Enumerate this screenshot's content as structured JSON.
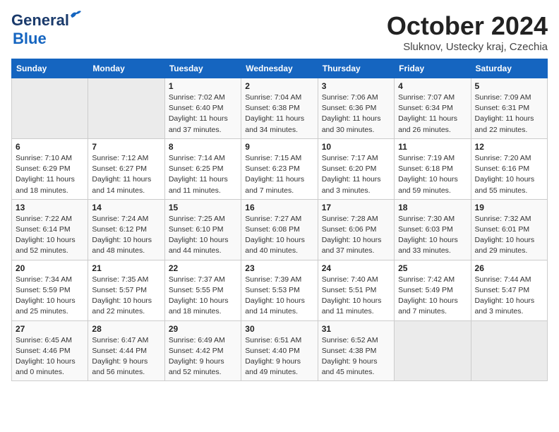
{
  "header": {
    "logo_general": "General",
    "logo_blue": "Blue",
    "month_title": "October 2024",
    "subtitle": "Sluknov, Ustecky kraj, Czechia"
  },
  "weekdays": [
    "Sunday",
    "Monday",
    "Tuesday",
    "Wednesday",
    "Thursday",
    "Friday",
    "Saturday"
  ],
  "weeks": [
    [
      {
        "day": "",
        "detail": ""
      },
      {
        "day": "",
        "detail": ""
      },
      {
        "day": "1",
        "detail": "Sunrise: 7:02 AM\nSunset: 6:40 PM\nDaylight: 11 hours\nand 37 minutes."
      },
      {
        "day": "2",
        "detail": "Sunrise: 7:04 AM\nSunset: 6:38 PM\nDaylight: 11 hours\nand 34 minutes."
      },
      {
        "day": "3",
        "detail": "Sunrise: 7:06 AM\nSunset: 6:36 PM\nDaylight: 11 hours\nand 30 minutes."
      },
      {
        "day": "4",
        "detail": "Sunrise: 7:07 AM\nSunset: 6:34 PM\nDaylight: 11 hours\nand 26 minutes."
      },
      {
        "day": "5",
        "detail": "Sunrise: 7:09 AM\nSunset: 6:31 PM\nDaylight: 11 hours\nand 22 minutes."
      }
    ],
    [
      {
        "day": "6",
        "detail": "Sunrise: 7:10 AM\nSunset: 6:29 PM\nDaylight: 11 hours\nand 18 minutes."
      },
      {
        "day": "7",
        "detail": "Sunrise: 7:12 AM\nSunset: 6:27 PM\nDaylight: 11 hours\nand 14 minutes."
      },
      {
        "day": "8",
        "detail": "Sunrise: 7:14 AM\nSunset: 6:25 PM\nDaylight: 11 hours\nand 11 minutes."
      },
      {
        "day": "9",
        "detail": "Sunrise: 7:15 AM\nSunset: 6:23 PM\nDaylight: 11 hours\nand 7 minutes."
      },
      {
        "day": "10",
        "detail": "Sunrise: 7:17 AM\nSunset: 6:20 PM\nDaylight: 11 hours\nand 3 minutes."
      },
      {
        "day": "11",
        "detail": "Sunrise: 7:19 AM\nSunset: 6:18 PM\nDaylight: 10 hours\nand 59 minutes."
      },
      {
        "day": "12",
        "detail": "Sunrise: 7:20 AM\nSunset: 6:16 PM\nDaylight: 10 hours\nand 55 minutes."
      }
    ],
    [
      {
        "day": "13",
        "detail": "Sunrise: 7:22 AM\nSunset: 6:14 PM\nDaylight: 10 hours\nand 52 minutes."
      },
      {
        "day": "14",
        "detail": "Sunrise: 7:24 AM\nSunset: 6:12 PM\nDaylight: 10 hours\nand 48 minutes."
      },
      {
        "day": "15",
        "detail": "Sunrise: 7:25 AM\nSunset: 6:10 PM\nDaylight: 10 hours\nand 44 minutes."
      },
      {
        "day": "16",
        "detail": "Sunrise: 7:27 AM\nSunset: 6:08 PM\nDaylight: 10 hours\nand 40 minutes."
      },
      {
        "day": "17",
        "detail": "Sunrise: 7:28 AM\nSunset: 6:06 PM\nDaylight: 10 hours\nand 37 minutes."
      },
      {
        "day": "18",
        "detail": "Sunrise: 7:30 AM\nSunset: 6:03 PM\nDaylight: 10 hours\nand 33 minutes."
      },
      {
        "day": "19",
        "detail": "Sunrise: 7:32 AM\nSunset: 6:01 PM\nDaylight: 10 hours\nand 29 minutes."
      }
    ],
    [
      {
        "day": "20",
        "detail": "Sunrise: 7:34 AM\nSunset: 5:59 PM\nDaylight: 10 hours\nand 25 minutes."
      },
      {
        "day": "21",
        "detail": "Sunrise: 7:35 AM\nSunset: 5:57 PM\nDaylight: 10 hours\nand 22 minutes."
      },
      {
        "day": "22",
        "detail": "Sunrise: 7:37 AM\nSunset: 5:55 PM\nDaylight: 10 hours\nand 18 minutes."
      },
      {
        "day": "23",
        "detail": "Sunrise: 7:39 AM\nSunset: 5:53 PM\nDaylight: 10 hours\nand 14 minutes."
      },
      {
        "day": "24",
        "detail": "Sunrise: 7:40 AM\nSunset: 5:51 PM\nDaylight: 10 hours\nand 11 minutes."
      },
      {
        "day": "25",
        "detail": "Sunrise: 7:42 AM\nSunset: 5:49 PM\nDaylight: 10 hours\nand 7 minutes."
      },
      {
        "day": "26",
        "detail": "Sunrise: 7:44 AM\nSunset: 5:47 PM\nDaylight: 10 hours\nand 3 minutes."
      }
    ],
    [
      {
        "day": "27",
        "detail": "Sunrise: 6:45 AM\nSunset: 4:46 PM\nDaylight: 10 hours\nand 0 minutes."
      },
      {
        "day": "28",
        "detail": "Sunrise: 6:47 AM\nSunset: 4:44 PM\nDaylight: 9 hours\nand 56 minutes."
      },
      {
        "day": "29",
        "detail": "Sunrise: 6:49 AM\nSunset: 4:42 PM\nDaylight: 9 hours\nand 52 minutes."
      },
      {
        "day": "30",
        "detail": "Sunrise: 6:51 AM\nSunset: 4:40 PM\nDaylight: 9 hours\nand 49 minutes."
      },
      {
        "day": "31",
        "detail": "Sunrise: 6:52 AM\nSunset: 4:38 PM\nDaylight: 9 hours\nand 45 minutes."
      },
      {
        "day": "",
        "detail": ""
      },
      {
        "day": "",
        "detail": ""
      }
    ]
  ]
}
